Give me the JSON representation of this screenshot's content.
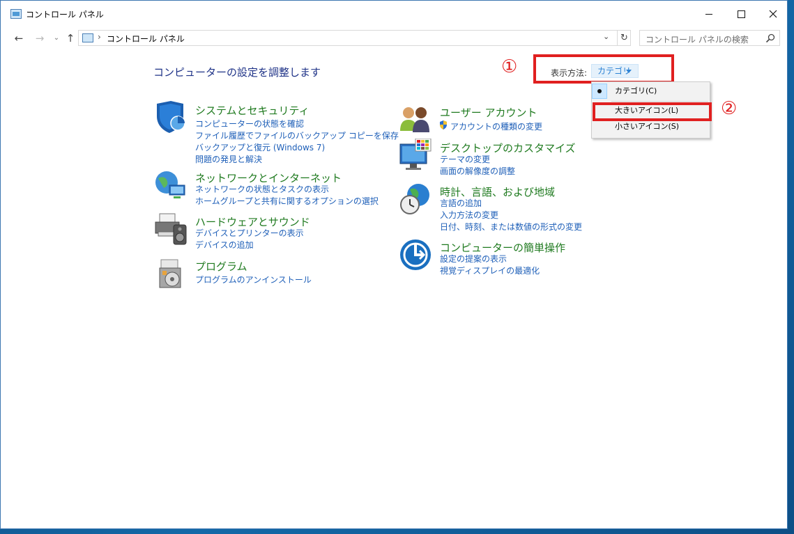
{
  "window": {
    "title": "コントロール パネル"
  },
  "nav": {
    "back_icon": "←",
    "forward_icon": "→",
    "recent_icon": "⌄",
    "up_icon": "↑"
  },
  "address": {
    "sep": "›",
    "path": "コントロール パネル",
    "dropdown_icon": "⌄",
    "refresh_icon": "↻"
  },
  "search": {
    "placeholder": "コントロール パネルの検索"
  },
  "main": {
    "heading": "コンピューターの設定を調整します",
    "view_by_label": "表示方法:",
    "view_by_value": "カテゴリ"
  },
  "view_menu": {
    "items": [
      {
        "label": "カテゴリ(C)",
        "selected": true
      },
      {
        "label": "大きいアイコン(L)",
        "selected": false
      },
      {
        "label": "小さいアイコン(S)",
        "selected": false
      }
    ]
  },
  "annotations": {
    "one": "①",
    "two": "②"
  },
  "categories_left": [
    {
      "title": "システムとセキュリティ",
      "icon": "shield-icon",
      "links": [
        "コンピューターの状態を確認",
        "ファイル履歴でファイルのバックアップ コピーを保存",
        "バックアップと復元 (Windows 7)",
        "問題の発見と解決"
      ]
    },
    {
      "title": "ネットワークとインターネット",
      "icon": "network-globe-icon",
      "links": [
        "ネットワークの状態とタスクの表示",
        "ホームグループと共有に関するオプションの選択"
      ]
    },
    {
      "title": "ハードウェアとサウンド",
      "icon": "printer-speaker-icon",
      "links": [
        "デバイスとプリンターの表示",
        "デバイスの追加"
      ]
    },
    {
      "title": "プログラム",
      "icon": "programs-icon",
      "links": [
        "プログラムのアンインストール"
      ]
    }
  ],
  "categories_right": [
    {
      "title": "ユーザー アカウント",
      "icon": "users-icon",
      "links": [
        "アカウントの種類の変更"
      ]
    },
    {
      "title": "デスクトップのカスタマイズ",
      "icon": "monitor-palette-icon",
      "links": [
        "テーマの変更",
        "画面の解像度の調整"
      ]
    },
    {
      "title": "時計、言語、および地域",
      "icon": "clock-globe-icon",
      "links": [
        "言語の追加",
        "入力方法の変更",
        "日付、時刻、または数値の形式の変更"
      ]
    },
    {
      "title": "コンピューターの簡単操作",
      "icon": "ease-of-access-icon",
      "links": [
        "設定の提案の表示",
        "視覚ディスプレイの最適化"
      ]
    }
  ]
}
